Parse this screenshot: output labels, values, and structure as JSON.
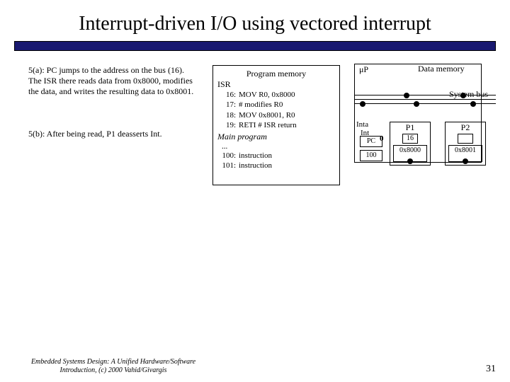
{
  "title": "Interrupt-driven I/O using vectored interrupt",
  "desc_a": "5(a): PC jumps to the address on the bus (16). The ISR there reads data from 0x8000, modifies the data, and writes the resulting data to 0x8001.",
  "desc_b": "5(b): After being read, P1 deasserts Int.",
  "progmem": {
    "header": "Program memory",
    "isr_label": "ISR",
    "lines": [
      {
        "n": "16:",
        "t": "MOV R0, 0x8000"
      },
      {
        "n": "17:",
        "t": "# modifies R0"
      },
      {
        "n": "18:",
        "t": "MOV 0x8001, R0"
      },
      {
        "n": "19:",
        "t": "RETI  # ISR return"
      }
    ],
    "main_label": "Main program",
    "ellipsis": "...",
    "main_lines": [
      {
        "n": "100:",
        "t": "instruction"
      },
      {
        "n": "101:",
        "t": "instruction"
      }
    ]
  },
  "cpu": {
    "label": "μP",
    "datamem": "Data memory",
    "sysbus": "System bus",
    "inta": "Inta",
    "int": "Int",
    "zero": "0",
    "pc": "PC",
    "pcval": "100"
  },
  "P1": {
    "label": "P1",
    "addr": "16",
    "val": "0x8000"
  },
  "P2": {
    "label": "P2",
    "addr": "",
    "val": "0x8001"
  },
  "footer": {
    "book": "Embedded Systems Design: A Unified Hardware/Software Introduction, (c) 2000 Vahid/Givargis",
    "page": "31"
  }
}
